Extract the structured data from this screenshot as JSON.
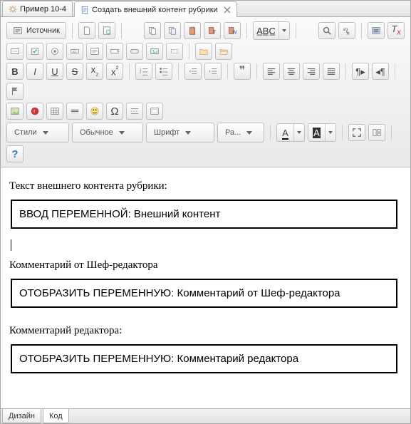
{
  "tabs_top": [
    {
      "label": "Пример 10-4",
      "active": false
    },
    {
      "label": "Создать внешний контент рубрики",
      "active": true
    }
  ],
  "toolbar": {
    "source": "Источник",
    "dropdowns": {
      "styles": "Стили",
      "format": "Обычное",
      "font": "Шрифт",
      "size": "Ра..."
    }
  },
  "content": {
    "p1": "Текст внешнего контента рубрики:",
    "v1": "ВВОД ПЕРЕМЕННОЙ: Внешний контент",
    "p2": "Комментарий от Шеф-редактора",
    "v2": "ОТОБРАЗИТЬ ПЕРЕМЕННУЮ: Комментарий от Шеф-редактора",
    "p3": "Комментарий редактора:",
    "v3": "ОТОБРАЗИТЬ ПЕРЕМЕННУЮ: Комментарий редактора"
  },
  "bottom": {
    "design": "Дизайн",
    "code": "Код"
  }
}
